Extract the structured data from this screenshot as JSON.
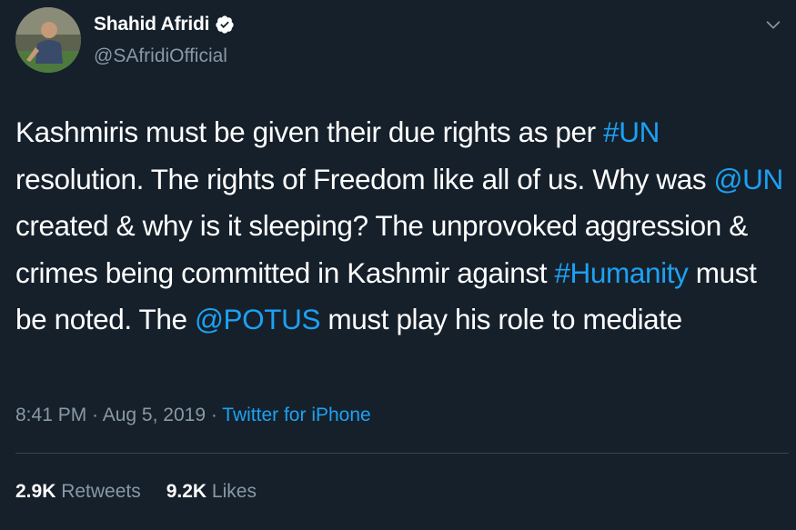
{
  "user": {
    "display_name": "Shahid Afridi",
    "handle": "@SAfridiOfficial",
    "verified": true
  },
  "tweet": {
    "segments": [
      {
        "text": "Kashmiris must be given their due rights as per ",
        "link": false
      },
      {
        "text": "#UN",
        "link": true
      },
      {
        "text": " resolution. The rights of Freedom like all of us. Why was ",
        "link": false
      },
      {
        "text": "@UN",
        "link": true
      },
      {
        "text": " created & why is it sleeping? The unprovoked aggression & crimes being committed in Kashmir against ",
        "link": false
      },
      {
        "text": "#Humanity",
        "link": true
      },
      {
        "text": " must be noted. The ",
        "link": false
      },
      {
        "text": "@POTUS",
        "link": true
      },
      {
        "text": " must play his role to mediate",
        "link": false
      }
    ]
  },
  "meta": {
    "time": "8:41 PM",
    "separator": " · ",
    "date": "Aug 5, 2019",
    "source": "Twitter for iPhone"
  },
  "stats": {
    "retweets_count": "2.9K",
    "retweets_label": " Retweets",
    "likes_count": "9.2K",
    "likes_label": " Likes"
  },
  "icons": {
    "verified": "verified-badge-icon",
    "caret": "chevron-down-icon"
  },
  "colors": {
    "background": "#15202b",
    "link": "#1da1f2",
    "secondary_text": "#8899a6",
    "divider": "#38444d"
  }
}
